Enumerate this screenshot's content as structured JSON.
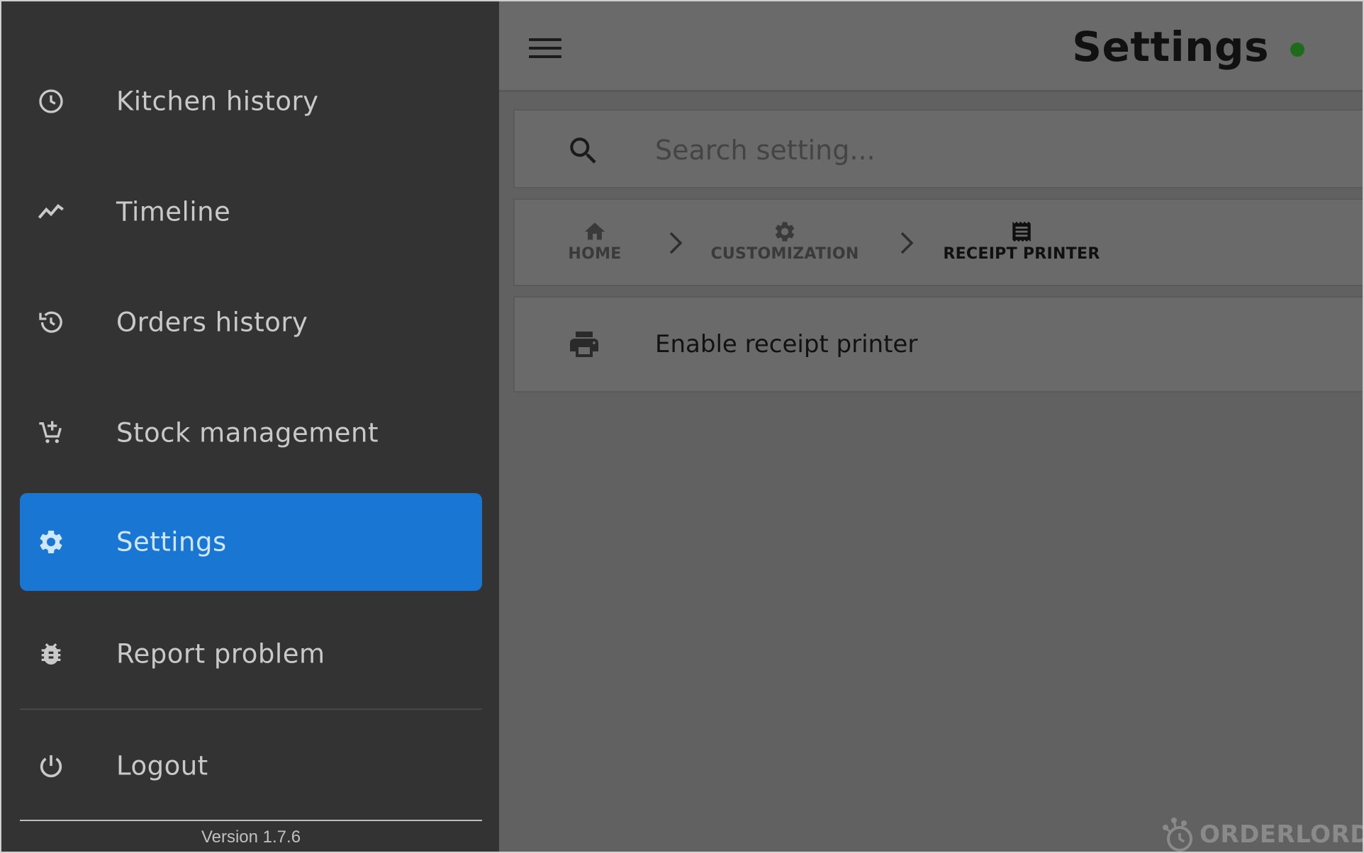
{
  "header": {
    "menu_icon": "hamburger-icon",
    "title": "Settings",
    "status_color": "#1e6b1e"
  },
  "search": {
    "icon": "search-icon",
    "placeholder": "Search setting..."
  },
  "breadcrumb": {
    "items": [
      {
        "label": "HOME",
        "icon": "home-icon"
      },
      {
        "label": "CUSTOMIZATION",
        "icon": "gear-icon"
      },
      {
        "label": "RECEIPT PRINTER",
        "icon": "receipt-icon"
      }
    ],
    "separator_icon": "chevron-right-icon"
  },
  "settings_list": [
    {
      "label": "Enable receipt printer",
      "icon": "printer-icon"
    }
  ],
  "sidebar": {
    "items": [
      {
        "label": "Kitchen history",
        "icon": "clock-icon"
      },
      {
        "label": "Timeline",
        "icon": "trending-icon"
      },
      {
        "label": "Orders history",
        "icon": "history-icon"
      },
      {
        "label": "Stock management",
        "icon": "cart-add-icon"
      },
      {
        "label": "Settings",
        "icon": "gear-icon",
        "active": true
      },
      {
        "label": "Report problem",
        "icon": "bug-icon"
      },
      {
        "label": "Logout",
        "icon": "power-icon"
      }
    ],
    "version": "Version 1.7.6",
    "active_color": "#1976d2"
  },
  "watermark": {
    "text": "ORDERLORD",
    "icon": "orderlord-logo-icon"
  }
}
